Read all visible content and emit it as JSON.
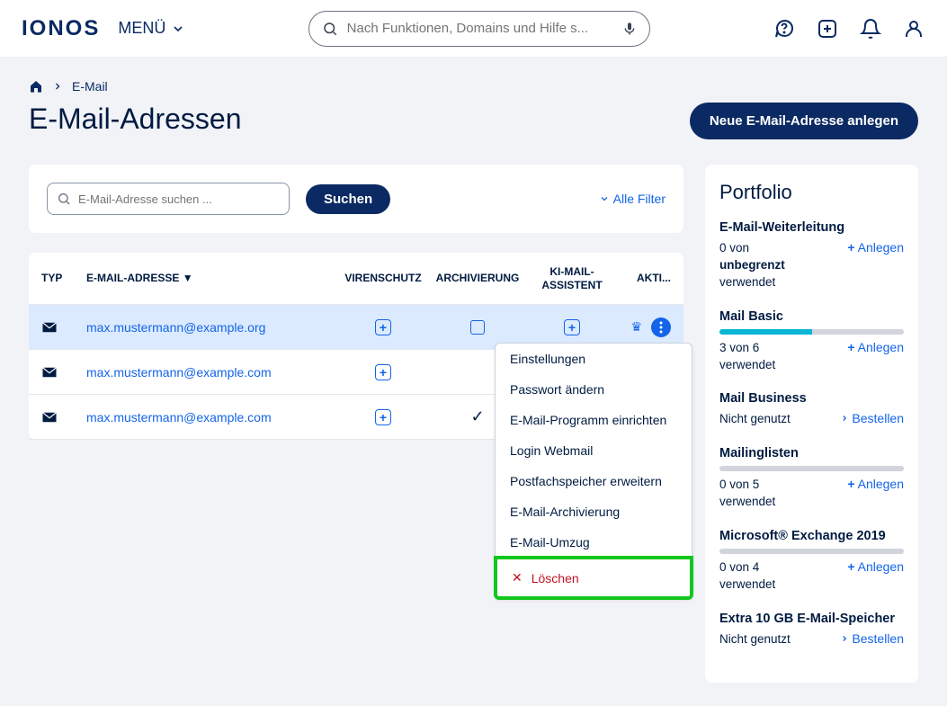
{
  "header": {
    "logo": "IONOS",
    "menu": "MENÜ",
    "search_placeholder": "Nach Funktionen, Domains und Hilfe s..."
  },
  "breadcrumb": {
    "current": "E-Mail"
  },
  "page_title": "E-Mail-Adressen",
  "primary_button": "Neue E-Mail-Adresse anlegen",
  "search_panel": {
    "placeholder": "E-Mail-Adresse suchen ...",
    "button": "Suchen",
    "filter": "Alle Filter"
  },
  "table": {
    "headers": {
      "type": "TYP",
      "email": "E-MAIL-ADRESSE",
      "virus": "VIRENSCHUTZ",
      "archive": "ARCHIVIERUNG",
      "ai": "KI-MAIL-ASSISTENT",
      "actions": "AKTI..."
    },
    "rows": [
      {
        "email": "max.mustermann@example.org",
        "virus": "plus",
        "archive": "box",
        "ai": "plus",
        "crown": true,
        "highlight": true,
        "menu_open": true
      },
      {
        "email": "max.mustermann@example.com",
        "virus": "plus",
        "archive": "",
        "ai": "",
        "crown": false,
        "highlight": false,
        "menu_open": false
      },
      {
        "email": "max.mustermann@example.com",
        "virus": "plus",
        "archive": "check",
        "ai": "",
        "crown": false,
        "highlight": false,
        "menu_open": false
      }
    ]
  },
  "context_menu": {
    "items": [
      "Einstellungen",
      "Passwort ändern",
      "E-Mail-Programm einrichten",
      "Login Webmail",
      "Postfachspeicher erweitern",
      "E-Mail-Archivierung",
      "E-Mail-Umzug"
    ],
    "delete": "Löschen"
  },
  "portfolio": {
    "title": "Portfolio",
    "items": [
      {
        "title": "E-Mail-Weiterleitung",
        "line1": "0 von",
        "line2_bold": "unbegrenzt",
        "line3": "verwendet",
        "action": "Anlegen",
        "bar": null
      },
      {
        "title": "Mail Basic",
        "line1": "3 von 6",
        "line3": "verwendet",
        "action": "Anlegen",
        "bar": 50
      },
      {
        "title": "Mail Business",
        "line1": "Nicht genutzt",
        "action": "Bestellen",
        "action_prefix": "chevron"
      },
      {
        "title": "Mailinglisten",
        "line1": "0 von 5",
        "line3": "verwendet",
        "action": "Anlegen",
        "bar": 0
      },
      {
        "title": "Microsoft® Exchange 2019",
        "line1": "0 von 4",
        "line3": "verwendet",
        "action": "Anlegen",
        "bar": 0
      },
      {
        "title": "Extra 10 GB E-Mail-Speicher",
        "line1": "Nicht genutzt",
        "action": "Bestellen",
        "action_prefix": "chevron"
      }
    ]
  }
}
